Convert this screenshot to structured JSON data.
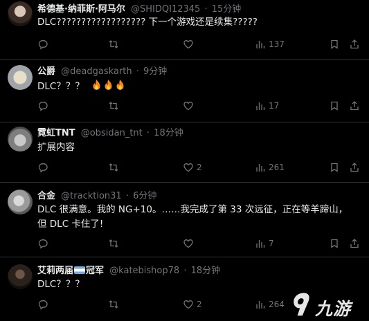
{
  "tweets": [
    {
      "name": "希德基·纳菲斯·阿马尔",
      "handle": "@SHIDQI12345",
      "time": "15分钟",
      "text": "DLC?????????????????? 下一个游戏还是续集?????",
      "replies": "",
      "retweets": "",
      "likes": "",
      "views": "137"
    },
    {
      "name": "公爵",
      "handle": "@deadgaskarth",
      "time": "9分钟",
      "text": "DLC？？？",
      "emoji": [
        "fire",
        "fire",
        "fire"
      ],
      "replies": "",
      "retweets": "",
      "likes": "",
      "views": "17"
    },
    {
      "name": "霓虹TNT",
      "handle": "@obsidan_tnt",
      "time": "18分钟",
      "text": "扩展内容",
      "replies": "",
      "retweets": "",
      "likes": "2",
      "views": "261"
    },
    {
      "name": "合金",
      "handle": "@tracktion31",
      "time": "6分钟",
      "text": "DLC 很满意。我的 NG+10。……我完成了第 33 次远征，正在等羊蹄山，但 DLC 卡住了!",
      "replies": "",
      "retweets": "",
      "likes": "",
      "views": "7"
    },
    {
      "name_part1": "艾莉两届",
      "name_part2": "冠军",
      "handle": "@katebishop78",
      "time": "18分钟",
      "text": "DLC？？？",
      "replies": "",
      "retweets": "",
      "likes": "2",
      "views": "264"
    }
  ],
  "separator": "·",
  "watermark": {
    "text": "九游"
  },
  "colors": {
    "background": "#000000",
    "text": "#e7e9ea",
    "muted": "#71767b",
    "border": "#2f3336"
  }
}
